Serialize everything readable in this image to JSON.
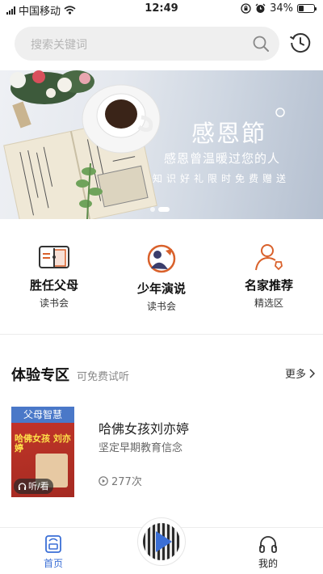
{
  "status_bar": {
    "carrier": "中国移动",
    "time": "12:49",
    "battery": "34%",
    "battery_level": 0.34
  },
  "search": {
    "placeholder": "搜索关键词"
  },
  "banner": {
    "title": "感恩節",
    "subtitle": "感恩曾温暖过您的人",
    "tagline": "知识好礼限时免费赠送",
    "slide_count": 2,
    "active_slide": 2
  },
  "categories": [
    {
      "title": "胜任父母",
      "subtitle": "读书会",
      "icon": "open-book-icon"
    },
    {
      "title": "少年演说",
      "subtitle": "读书会",
      "icon": "speech-icon"
    },
    {
      "title": "名家推荐",
      "subtitle": "精选区",
      "icon": "person-badge-icon"
    }
  ],
  "section": {
    "title": "体验专区",
    "subtitle": "可免费试听",
    "more": "更多"
  },
  "book": {
    "cover_tag": "父母智慧",
    "cover_text": "哈佛女孩 刘亦婷",
    "badge": "听/看",
    "title": "哈佛女孩刘亦婷",
    "description": "坚定早期教育信念",
    "plays": "277次"
  },
  "tabs": [
    {
      "label": "首页",
      "icon": "home-icon",
      "active": true
    },
    {
      "label": "我的",
      "icon": "headphones-icon",
      "active": false
    }
  ],
  "colors": {
    "accent": "#3b6fd6",
    "category_icon": "#d9612b",
    "cover_tag": "#4a78c8"
  }
}
